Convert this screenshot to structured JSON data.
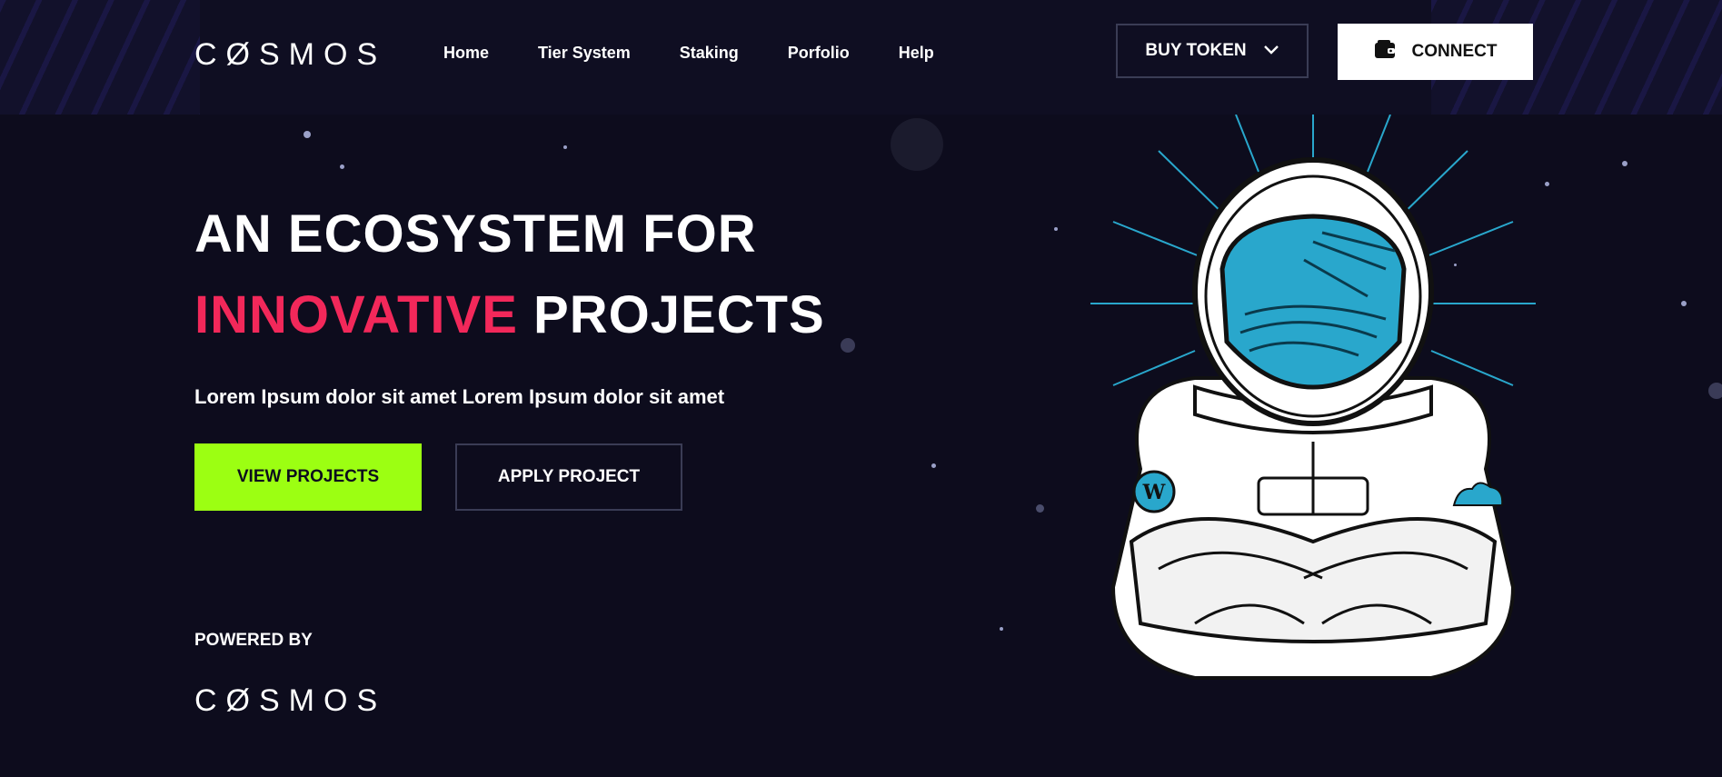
{
  "header": {
    "logo_text": "CØSMOS",
    "nav": [
      {
        "label": "Home"
      },
      {
        "label": "Tier System"
      },
      {
        "label": "Staking"
      },
      {
        "label": "Porfolio"
      },
      {
        "label": "Help"
      }
    ],
    "buy_token_label": "BUY TOKEN",
    "connect_label": "CONNECT",
    "icons": {
      "buy_token": "chevron-down-icon",
      "connect": "wallet-icon"
    }
  },
  "hero": {
    "line1": "AN ECOSYSTEM FOR",
    "line2_highlight": "INNOVATIVE",
    "line2_rest": "PROJECTS",
    "subtitle": "Lorem Ipsum dolor sit amet Lorem Ipsum dolor sit amet",
    "view_projects_label": "VIEW PROJECTS",
    "apply_project_label": "APPLY PROJECT"
  },
  "footer": {
    "powered_by": "POWERED BY",
    "logo_text": "CØSMOS"
  },
  "colors": {
    "background": "#0d0c1d",
    "accent_pink": "#f2285a",
    "accent_green": "#9cff12",
    "visor_blue": "#29a7cc"
  }
}
